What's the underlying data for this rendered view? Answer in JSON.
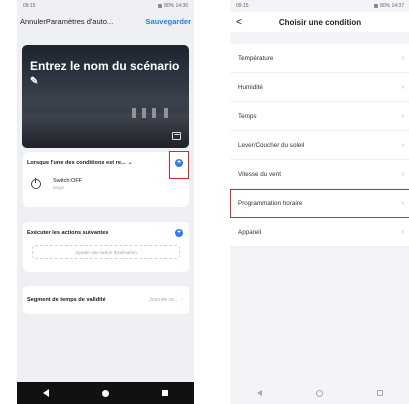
{
  "left": {
    "status": {
      "time": "09:15",
      "battery": "80% 14:36"
    },
    "header": {
      "cancel": "Annuler",
      "title": "Paramètres d'auto...",
      "save": "Sauvegarder"
    },
    "cover": {
      "title": "Entrez le nom du scénario"
    },
    "conditions": {
      "label": "Lorsque l'une des conditions est re..."
    },
    "switch_item": {
      "label": "Switch:OFF",
      "sub": "plugs"
    },
    "actions": {
      "label": "Exécuter les actions suivantes",
      "add": "Ajouter une action d'exécution"
    },
    "validity": {
      "label": "Segment de temps de validité",
      "value": "Journée co..."
    }
  },
  "right": {
    "status": {
      "time": "09:15",
      "battery": "80% 14:37"
    },
    "header": {
      "back": "<",
      "title": "Choisir une condition"
    },
    "items": [
      {
        "label": "Température",
        "highlight": false
      },
      {
        "label": "Humidité",
        "highlight": false
      },
      {
        "label": "Temps",
        "highlight": false
      },
      {
        "label": "Lever/Coucher du soleil",
        "highlight": false
      },
      {
        "label": "Vitesse du vent",
        "highlight": false
      },
      {
        "label": "Programmation horaire",
        "highlight": true
      },
      {
        "label": "Appareil",
        "highlight": false
      }
    ]
  },
  "colors": {
    "accent": "#2a7de1",
    "highlight": "#d9262b"
  }
}
